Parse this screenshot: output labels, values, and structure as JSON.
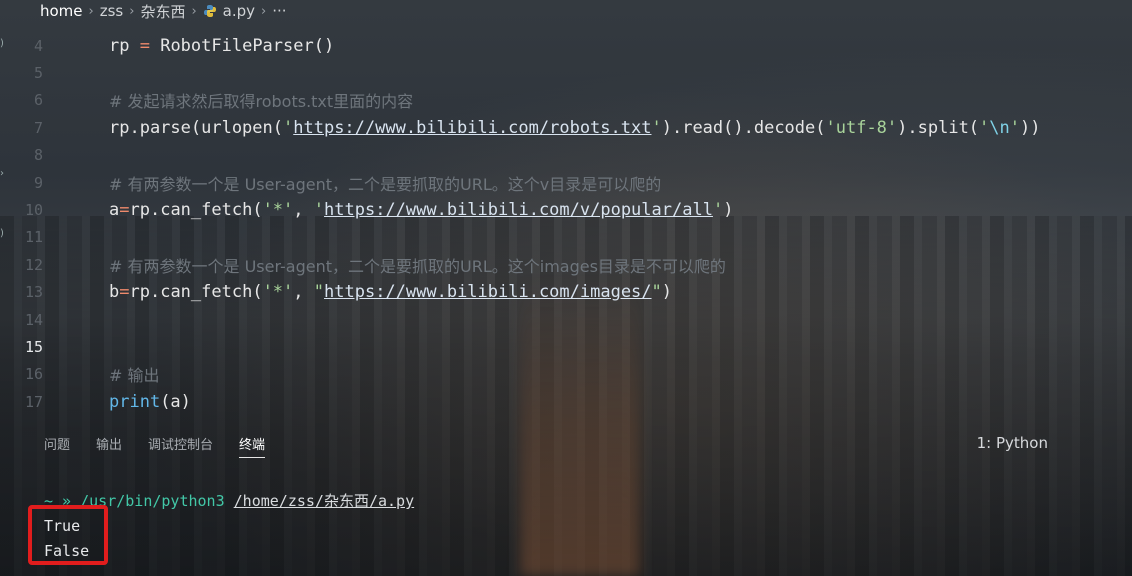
{
  "breadcrumb": {
    "items": [
      "home",
      "zss",
      "杂东西"
    ],
    "file": "a.py",
    "more": "···"
  },
  "editor": {
    "active_line": "15",
    "lines": [
      {
        "num": "4",
        "parts": [
          [
            "fn",
            "rp "
          ],
          [
            "op",
            "="
          ],
          [
            "fn",
            " RobotFileParser()"
          ]
        ]
      },
      {
        "num": "5",
        "parts": []
      },
      {
        "num": "6",
        "parts": [
          [
            "cmt",
            "# 发起请求然后取得robots.txt里面的内容"
          ]
        ]
      },
      {
        "num": "7",
        "parts": [
          [
            "fn",
            "rp.parse(urlopen("
          ],
          [
            "str",
            "'"
          ],
          [
            "url",
            "https://www.bilibili.com/robots.txt"
          ],
          [
            "str",
            "'"
          ],
          [
            "fn",
            ").read().decode("
          ],
          [
            "str",
            "'utf-8'"
          ],
          [
            "fn",
            ").split("
          ],
          [
            "str",
            "'"
          ],
          [
            "esc",
            "\\n"
          ],
          [
            "str",
            "'"
          ],
          [
            "fn",
            "))"
          ]
        ]
      },
      {
        "num": "8",
        "parts": []
      },
      {
        "num": "9",
        "parts": [
          [
            "cmt",
            "# 有两参数一个是 User-agent，二个是要抓取的URL。这个v目录是可以爬的"
          ]
        ]
      },
      {
        "num": "10",
        "parts": [
          [
            "fn",
            "a"
          ],
          [
            "op",
            "="
          ],
          [
            "fn",
            "rp.can_fetch("
          ],
          [
            "str",
            "'*'"
          ],
          [
            "fn",
            ", "
          ],
          [
            "str",
            "'"
          ],
          [
            "url",
            "https://www.bilibili.com/v/popular/all"
          ],
          [
            "str",
            "'"
          ],
          [
            "fn",
            ")"
          ]
        ]
      },
      {
        "num": "11",
        "parts": []
      },
      {
        "num": "12",
        "parts": [
          [
            "cmt",
            "# 有两参数一个是 User-agent，二个是要抓取的URL。这个images目录是不可以爬的"
          ]
        ]
      },
      {
        "num": "13",
        "parts": [
          [
            "fn",
            "b"
          ],
          [
            "op",
            "="
          ],
          [
            "fn",
            "rp.can_fetch("
          ],
          [
            "str",
            "'*'"
          ],
          [
            "fn",
            ", "
          ],
          [
            "str",
            "\""
          ],
          [
            "url",
            "https://www.bilibili.com/images/"
          ],
          [
            "str",
            "\""
          ],
          [
            "fn",
            ")"
          ]
        ]
      },
      {
        "num": "14",
        "parts": []
      },
      {
        "num": "15",
        "parts": []
      },
      {
        "num": "16",
        "parts": [
          [
            "cmt",
            "# 输出"
          ]
        ]
      },
      {
        "num": "17",
        "parts": [
          [
            "kw",
            "print"
          ],
          [
            "fn",
            "(a)"
          ]
        ]
      }
    ]
  },
  "panel": {
    "tabs": [
      "问题",
      "输出",
      "调试控制台",
      "终端"
    ],
    "active_tab": "终端",
    "terminal_select": "1: Python",
    "terminal": {
      "prompt": "~ »",
      "command": "/usr/bin/python3",
      "path": "/home/zss/杂东西/a.py",
      "output": [
        "True",
        "False"
      ]
    }
  },
  "colors": {
    "highlight": "#e11d1d",
    "keyword": "#62b7e8",
    "string": "#a8d39a",
    "terminal_prompt": "#42c7a7"
  }
}
